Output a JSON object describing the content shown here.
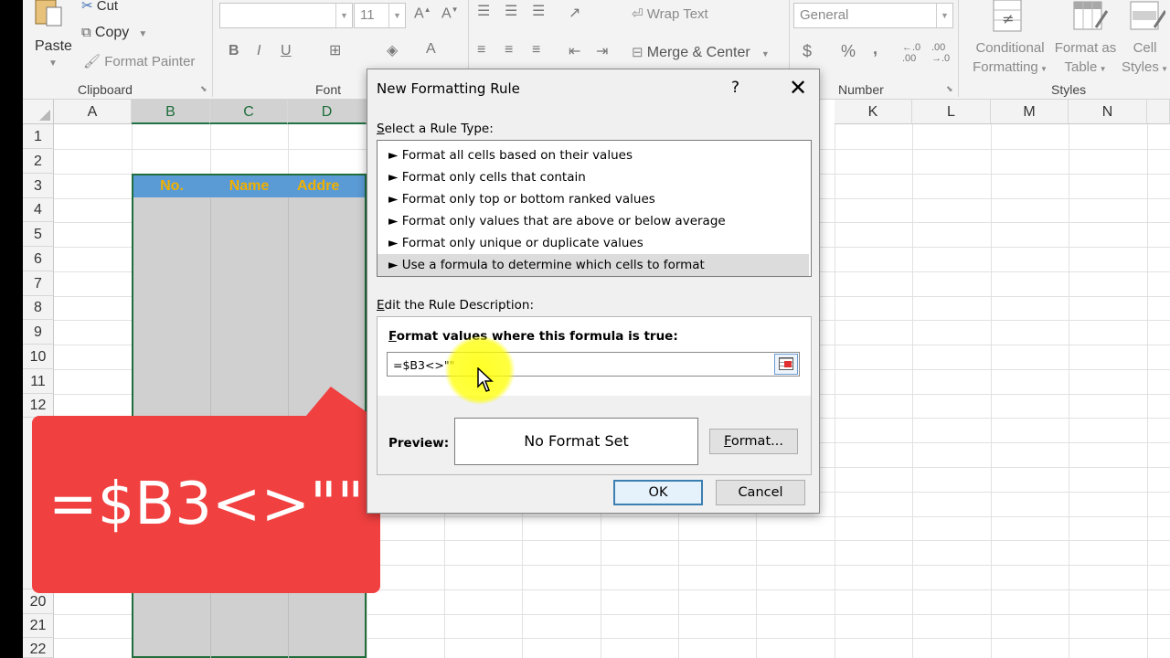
{
  "ribbon": {
    "clipboard": {
      "cut": "Cut",
      "copy": "Copy",
      "format_painter": "Format Painter",
      "paste": "Paste",
      "group_label": "Clipboard"
    },
    "font": {
      "size": "11",
      "group_label": "Font"
    },
    "alignment": {
      "wrap_text": "Wrap Text",
      "merge_center": "Merge & Center"
    },
    "number": {
      "format": "General",
      "group_label": "Number",
      "currency": "$",
      "percent": "%",
      "comma": ","
    },
    "styles": {
      "conditional_formatting_1": "Conditional",
      "conditional_formatting_2": "Formatting",
      "format_as_table_1": "Format as",
      "format_as_table_2": "Table",
      "cell_styles_1": "Cell",
      "cell_styles_2": "Styles",
      "group_label": "Styles"
    }
  },
  "sheet": {
    "columns": [
      "A",
      "B",
      "C",
      "D",
      "K",
      "L",
      "M",
      "N"
    ],
    "rows": [
      "1",
      "2",
      "3",
      "4",
      "5",
      "6",
      "7",
      "8",
      "9",
      "10",
      "11",
      "12",
      "20",
      "21",
      "22"
    ],
    "header_cells": [
      "No.",
      "Name",
      "Addre"
    ]
  },
  "dialog": {
    "title": "New Formatting Rule",
    "help": "?",
    "close": "✕",
    "select_rule_type_label": "Select a Rule Type:",
    "rule_types": [
      "Format all cells based on their values",
      "Format only cells that contain",
      "Format only top or bottom ranked values",
      "Format only values that are above or below average",
      "Format only unique or duplicate values",
      "Use a formula to determine which cells to format"
    ],
    "rule_bullet": "►",
    "selected_rule_index": 5,
    "edit_description_label": "Edit the Rule Description:",
    "formula_label": "Format values where this formula is true:",
    "formula_value": "=$B3<>\"\"",
    "preview_label": "Preview:",
    "preview_text": "No Format Set",
    "format_button": "Format...",
    "ok_button": "OK",
    "cancel_button": "Cancel"
  },
  "callout": {
    "text": "=$B3<>\"\""
  },
  "colors": {
    "excel_green": "#217346",
    "header_fill": "#5b9bd5",
    "header_text": "#f0b000",
    "callout_red": "#f04040",
    "highlight_yellow": "#ffff00"
  }
}
